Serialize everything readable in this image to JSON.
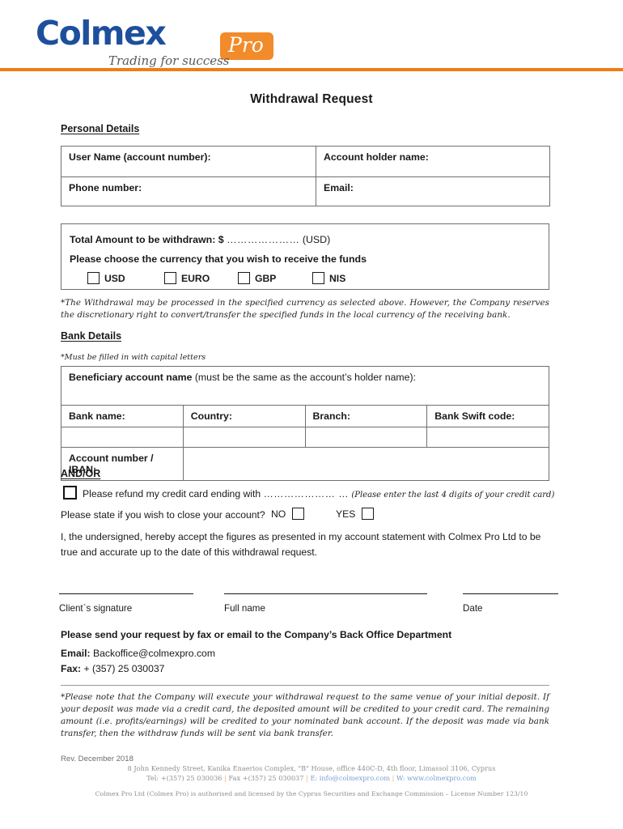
{
  "header": {
    "logo_main": "Colmex",
    "logo_badge": "Pro",
    "tagline": "Trading for success",
    "brand_blue": "#1e4f9c",
    "brand_orange": "#f28b29",
    "rule_color": "#f07d14"
  },
  "document": {
    "title": "Withdrawal Request"
  },
  "personal": {
    "heading": "Personal Details",
    "rows": [
      {
        "left": "User Name (account number):",
        "right": "Account holder name:"
      },
      {
        "left": "Phone number:",
        "right": "Email:"
      }
    ]
  },
  "amount": {
    "label": "Total Amount to be withdrawn: $",
    "dots": "…………………",
    "currency_note": "(USD)",
    "choose_label": "Please choose the currency that you wish to receive the funds",
    "options": [
      "USD",
      "EURO",
      "GBP",
      "NIS"
    ],
    "disclaimer": "*The Withdrawal may be processed in the specified currency as selected above. However, the Company reserves the discretionary right to convert/transfer the specified funds in the local currency of the receiving bank."
  },
  "bank": {
    "heading": "Bank Details",
    "capital_note": "*Must be filled in with capital letters",
    "beneficiary_bold": "Beneficiary account name",
    "beneficiary_rest": " (must be the same as the account’s holder name):",
    "columns": [
      "Bank name:",
      "Country:",
      "Branch:",
      "Bank Swift code:"
    ],
    "iban_label": "Account number / IBAN:"
  },
  "andor": {
    "heading": "AND/OR",
    "refund_text": "Please refund my credit card ending with",
    "refund_dots": "………………… …",
    "refund_paren": "(Please enter the last 4 digits of your credit card)",
    "close_question": "Please state if you wish to close your account?",
    "close_no": "NO",
    "close_yes": "YES",
    "undersigned": "I, the undersigned, hereby accept the figures as presented in my account statement with Colmex Pro Ltd to be true and accurate up to the date of this withdrawal request."
  },
  "signature": {
    "labels": [
      "Client`s signature",
      "Full name",
      "Date"
    ]
  },
  "contact": {
    "send_request": "Please send your request by fax or email to the Company’s Back Office Department",
    "email_label": "Email:",
    "email_value": "Backoffice@colmexpro.com",
    "fax_label": "Fax:",
    "fax_value": "+ (357) 25 030037"
  },
  "final_note": "*Please note that the Company will execute your withdrawal request to the same venue of your initial deposit. If your deposit was made via a credit card, the deposited amount will be credited to your credit card. The remaining amount (i.e. profits/earnings) will be credited to your nominated bank account. If the deposit was made via bank transfer, then the withdraw funds will be sent via bank transfer.",
  "revision": "Rev. December 2018",
  "footer": {
    "address": "8 John Kennedy Street, Kanika Enaerios Complex, \"B\" House, office 440C-D, 4th floor, Limassol 3106, Cyprus",
    "tel": "Tel: +(357) 25 030036",
    "fax": "Fax +(357) 25 030037",
    "email": "E: info@colmexpro.com",
    "web": "W: www.colmexpro.com",
    "license": "Colmex Pro Ltd (Colmex Pro) is authorised and licensed by the Cyprus Securities and Exchange Commission – License Number 123/10"
  }
}
